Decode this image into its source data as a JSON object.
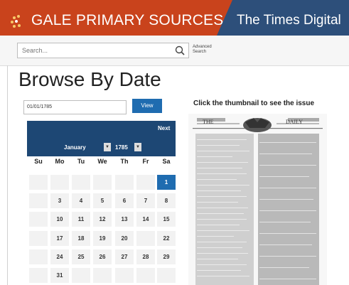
{
  "header": {
    "brand": "GALE PRIMARY SOURCES",
    "product": "The Times Digital",
    "brand_color": "#c9431c",
    "product_color": "#2d4f7a"
  },
  "search": {
    "placeholder": "Search...",
    "advanced_line1": "Advanced",
    "advanced_line2": "Search"
  },
  "page": {
    "title": "Browse By Date",
    "date_value": "01/01/1785",
    "view_label": "View",
    "thumbnail_caption": "Click the thumbnail to see the issue"
  },
  "calendar": {
    "next_label": "Next",
    "month": "January",
    "year": "1785",
    "weekdays": [
      "Su",
      "Mo",
      "Tu",
      "We",
      "Th",
      "Fr",
      "Sa"
    ],
    "selected_day": "1",
    "rows": [
      [
        "",
        "",
        "",
        "",
        "",
        "",
        "1"
      ],
      [
        "",
        "3",
        "4",
        "5",
        "6",
        "7",
        "8"
      ],
      [
        "",
        "10",
        "11",
        "12",
        "13",
        "14",
        "15"
      ],
      [
        "",
        "17",
        "18",
        "19",
        "20",
        "",
        "22"
      ],
      [
        "",
        "24",
        "25",
        "26",
        "27",
        "28",
        "29"
      ],
      [
        "",
        "31",
        "",
        "",
        "",
        "",
        ""
      ]
    ]
  },
  "thumbnail": {
    "title_left": "THE",
    "title_right": "DAILY"
  }
}
